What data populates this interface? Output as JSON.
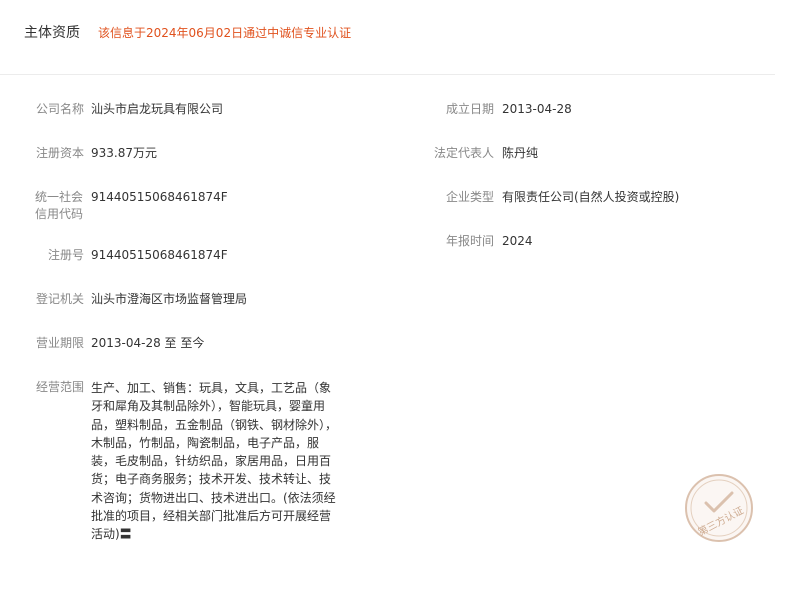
{
  "header": {
    "title": "主体资质",
    "notice": "该信息于2024年06月02日通过中诚信专业认证"
  },
  "colors": {
    "notice": "#e0521e",
    "label": "#888888",
    "value": "#333333",
    "stamp": "#c9a285"
  },
  "left_fields": [
    {
      "label": "公司名称",
      "value": "汕头市启龙玩具有限公司"
    },
    {
      "label": "注册资本",
      "value": "933.87万元"
    },
    {
      "label_line1": "统一社会",
      "label_line2": "信用代码",
      "value": "91440515068461874F"
    },
    {
      "label": "注册号",
      "value": "91440515068461874F"
    },
    {
      "label": "登记机关",
      "value": "汕头市澄海区市场监督管理局"
    },
    {
      "label": "营业期限",
      "value": "2013-04-28 至 至今"
    },
    {
      "label": "经营范围",
      "value": "生产、加工、销售：玩具，文具，工艺品（象牙和犀角及其制品除外），智能玩具，婴童用品，塑料制品，五金制品（钢铁、钢材除外），木制品，竹制品，陶瓷制品，电子产品，服装，毛皮制品，针纺织品，家居用品，日用百货；电子商务服务；技术开发、技术转让、技术咨询；货物进出口、技术进出口。(依法须经批准的项目，经相关部门批准后方可开展经营活动)〓"
    }
  ],
  "right_fields": [
    {
      "label": "成立日期",
      "value": "2013-04-28"
    },
    {
      "label": "法定代表人",
      "value": "陈丹纯"
    },
    {
      "label": "企业类型",
      "value": "有限责任公司(自然人投资或控股)"
    },
    {
      "label": "年报时间",
      "value": "2024"
    }
  ],
  "stamp": {
    "text": "第三方认证",
    "icon": "checkmark-seal-icon"
  }
}
